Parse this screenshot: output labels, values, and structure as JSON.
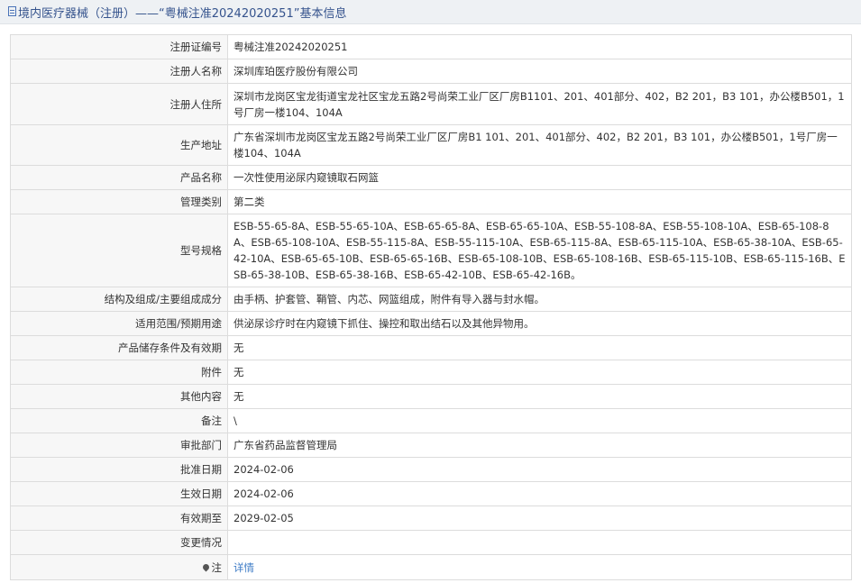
{
  "header": {
    "title": "境内医疗器械（注册）——“粤械注准20242020251”基本信息",
    "icon": "document-icon"
  },
  "rows": [
    {
      "label": "注册证编号",
      "value": "粤械注准20242020251"
    },
    {
      "label": "注册人名称",
      "value": "深圳库珀医疗股份有限公司"
    },
    {
      "label": "注册人住所",
      "value": "深圳市龙岗区宝龙街道宝龙社区宝龙五路2号尚荣工业厂区厂房B1101、201、401部分、402，B2 201，B3 101，办公楼B501，1号厂房一楼104、104A"
    },
    {
      "label": "生产地址",
      "value": "广东省深圳市龙岗区宝龙五路2号尚荣工业厂区厂房B1 101、201、401部分、402，B2 201，B3 101，办公楼B501，1号厂房一楼104、104A"
    },
    {
      "label": "产品名称",
      "value": "一次性使用泌尿内窥镜取石网篮"
    },
    {
      "label": "管理类别",
      "value": "第二类"
    },
    {
      "label": "型号规格",
      "value": "ESB-55-65-8A、ESB-55-65-10A、ESB-65-65-8A、ESB-65-65-10A、ESB-55-108-8A、ESB-55-108-10A、ESB-65-108-8A、ESB-65-108-10A、ESB-55-115-8A、ESB-55-115-10A、ESB-65-115-8A、ESB-65-115-10A、ESB-65-38-10A、ESB-65-42-10A、ESB-65-65-10B、ESB-65-65-16B、ESB-65-108-10B、ESB-65-108-16B、ESB-65-115-10B、ESB-65-115-16B、ESB-65-38-10B、ESB-65-38-16B、ESB-65-42-10B、ESB-65-42-16B。"
    },
    {
      "label": "结构及组成/主要组成成分",
      "value": "由手柄、护套管、鞘管、内芯、网篮组成，附件有导入器与封水帽。"
    },
    {
      "label": "适用范围/预期用途",
      "value": "供泌尿诊疗时在内窥镜下抓住、操控和取出结石以及其他异物用。"
    },
    {
      "label": "产品储存条件及有效期",
      "value": "无"
    },
    {
      "label": "附件",
      "value": "无"
    },
    {
      "label": "其他内容",
      "value": "无"
    },
    {
      "label": "备注",
      "value": "\\"
    },
    {
      "label": "审批部门",
      "value": "广东省药品监督管理局"
    },
    {
      "label": "批准日期",
      "value": "2024-02-06"
    },
    {
      "label": "生效日期",
      "value": "2024-02-06"
    },
    {
      "label": "有效期至",
      "value": "2029-02-05"
    },
    {
      "label": "变更情况",
      "value": ""
    }
  ],
  "note": {
    "label": "注",
    "icon": "pin-icon",
    "link_text": "详情"
  }
}
